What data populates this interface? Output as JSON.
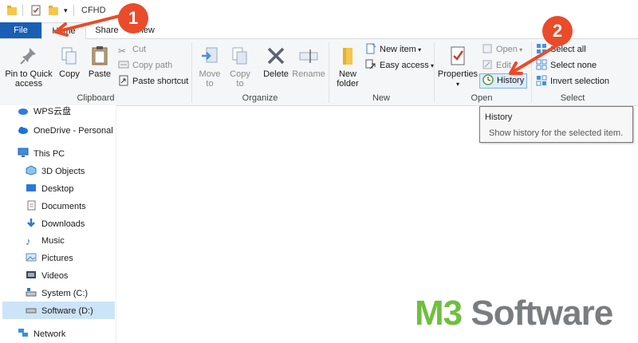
{
  "window": {
    "title": "CFHD"
  },
  "tabs": {
    "file": "File",
    "home": "Home",
    "share": "Share",
    "view": "View"
  },
  "ribbon": {
    "clipboard": {
      "label": "Clipboard",
      "pin": "Pin to Quick access",
      "copy": "Copy",
      "paste": "Paste",
      "cut": "Cut",
      "copy_path": "Copy path",
      "paste_shortcut": "Paste shortcut"
    },
    "organize": {
      "label": "Organize",
      "move_to": "Move to",
      "copy_to": "Copy to",
      "delete": "Delete",
      "rename": "Rename"
    },
    "new": {
      "label": "New",
      "new_folder": "New folder",
      "new_item": "New item",
      "easy_access": "Easy access"
    },
    "open": {
      "label": "Open",
      "properties": "Properties",
      "open": "Open",
      "edit": "Edit",
      "history": "History"
    },
    "select": {
      "label": "Select",
      "select_all": "Select all",
      "select_none": "Select none",
      "invert_selection": "Invert selection"
    }
  },
  "tooltip": {
    "title": "History",
    "body": "Show history for the selected item."
  },
  "sidebar": {
    "items": [
      {
        "label": "WPS云盘"
      },
      {
        "label": "OneDrive - Personal"
      },
      {
        "label": "This PC"
      },
      {
        "label": "3D Objects"
      },
      {
        "label": "Desktop"
      },
      {
        "label": "Documents"
      },
      {
        "label": "Downloads"
      },
      {
        "label": "Music"
      },
      {
        "label": "Pictures"
      },
      {
        "label": "Videos"
      },
      {
        "label": "System (C:)"
      },
      {
        "label": "Software (D:)"
      },
      {
        "label": "Network"
      }
    ]
  },
  "annotations": {
    "step1": "1",
    "step2": "2"
  },
  "watermark": {
    "m3": "M3",
    "software": " Software"
  },
  "colors": {
    "accent": "#1a5fb4",
    "badge": "#e94b2b",
    "watermark_green": "#6fbf3f",
    "watermark_gray": "#7a7d80"
  }
}
